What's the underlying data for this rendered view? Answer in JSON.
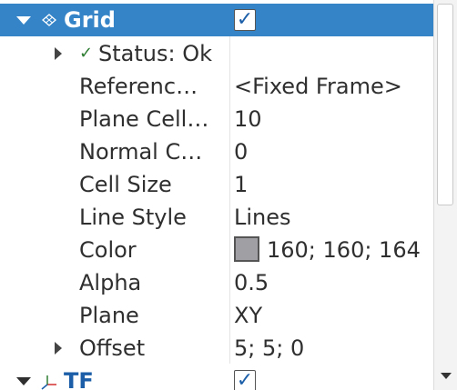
{
  "grid": {
    "name": "Grid",
    "enabled": true,
    "checkmark": "✓",
    "icon": "grid-icon"
  },
  "status": {
    "check": "✓",
    "label": "Status: Ok"
  },
  "properties": [
    {
      "name": "Referenc…",
      "value": "<Fixed Frame>"
    },
    {
      "name": "Plane Cell…",
      "value": "10"
    },
    {
      "name": "Normal C…",
      "value": "0"
    },
    {
      "name": "Cell Size",
      "value": "1"
    },
    {
      "name": "Line Style",
      "value": "Lines"
    },
    {
      "name": "Color",
      "value": "160; 160; 164",
      "swatch_color": "#a0a0a4"
    },
    {
      "name": "Alpha",
      "value": "0.5"
    },
    {
      "name": "Plane",
      "value": "XY"
    },
    {
      "name": "Offset",
      "value": "5; 5; 0"
    }
  ],
  "tf": {
    "name": "TF",
    "enabled": true,
    "checkmark": "✓",
    "icon": "tf-axes-icon"
  },
  "colors": {
    "selection": "#3584c8",
    "status_check": "#2e7d32",
    "tf_label": "#1c5fa8"
  }
}
